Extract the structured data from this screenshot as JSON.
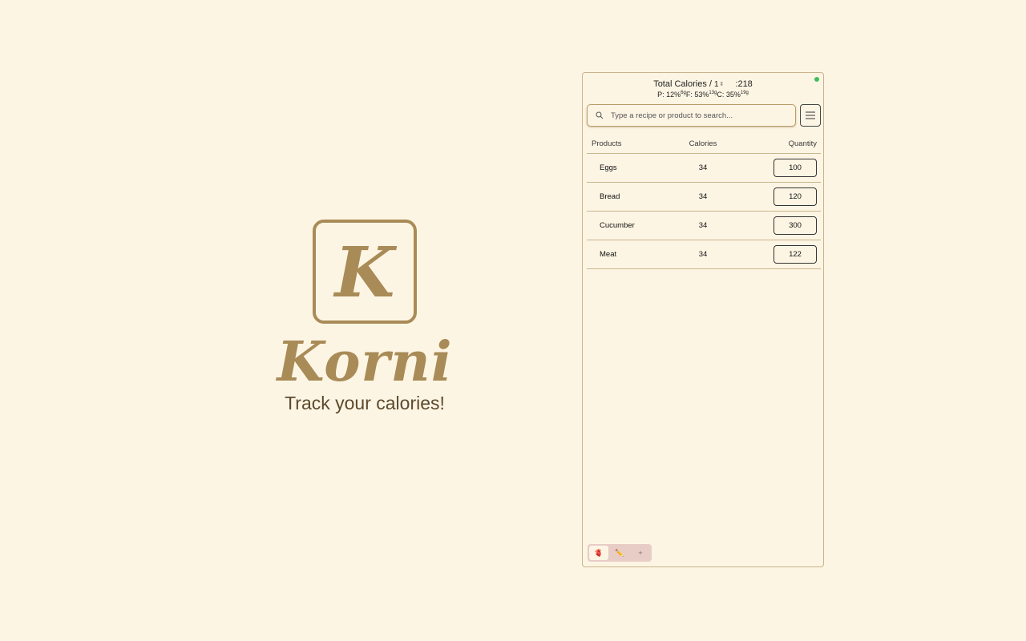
{
  "brand": {
    "logo_letter": "K",
    "name": "Korni",
    "tagline": "Track your calories!",
    "accent_color": "#a98b57"
  },
  "panel": {
    "status_color": "#3fbf5a",
    "totals": {
      "label": "Total Calories /",
      "portion_value": "1",
      "calories_value": ":218"
    },
    "macros": {
      "p_label": "P: 12%",
      "p_grams": "6g",
      "f_label": "F: 53%",
      "f_grams": "13g",
      "c_label": "C: 35%",
      "c_grams": "19g"
    },
    "search": {
      "placeholder": "Type a recipe or product to search..."
    },
    "table": {
      "headers": {
        "products": "Products",
        "calories": "Calories",
        "quantity": "Quantity"
      },
      "rows": [
        {
          "name": "Eggs",
          "calories": "34",
          "quantity": "100"
        },
        {
          "name": "Bread",
          "calories": "34",
          "quantity": "120"
        },
        {
          "name": "Cucumber",
          "calories": "34",
          "quantity": "300"
        },
        {
          "name": "Meat",
          "calories": "34",
          "quantity": "122"
        }
      ]
    },
    "tabs": [
      {
        "icon": "brain-icon",
        "glyph": "🫀",
        "active": true
      },
      {
        "icon": "pencil-icon",
        "glyph": "✏️",
        "active": false
      },
      {
        "icon": "plus-icon",
        "glyph": "+",
        "active": false
      }
    ]
  }
}
